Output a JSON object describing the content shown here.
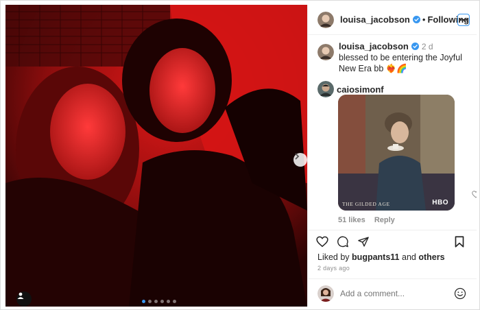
{
  "header": {
    "username": "louisa_jacobson",
    "separator": "•",
    "follow_status": "Following",
    "more_icon": "more-horizontal-icon",
    "verified_color": "#3897f0"
  },
  "caption": {
    "username": "louisa_jacobson",
    "time": "2 d",
    "text": "blessed to be entering the Joyful New Era bb ❤️‍🔥🌈"
  },
  "comment": {
    "username": "caiosimonf",
    "gif_watermark": "HBO",
    "gif_caption": "THE GILDED AGE",
    "likes": "51 likes",
    "reply_label": "Reply"
  },
  "actions": {
    "liked_prefix": "Liked by",
    "liked_user": "bugpants11",
    "liked_and": "and",
    "liked_others": "others",
    "posted_ago": "2 days ago",
    "comment_placeholder": "Add a comment..."
  },
  "carousel": {
    "slide_count": 6,
    "active_index": 0
  },
  "colors": {
    "accent": "#3897f0",
    "photo_red": "#b31414"
  }
}
